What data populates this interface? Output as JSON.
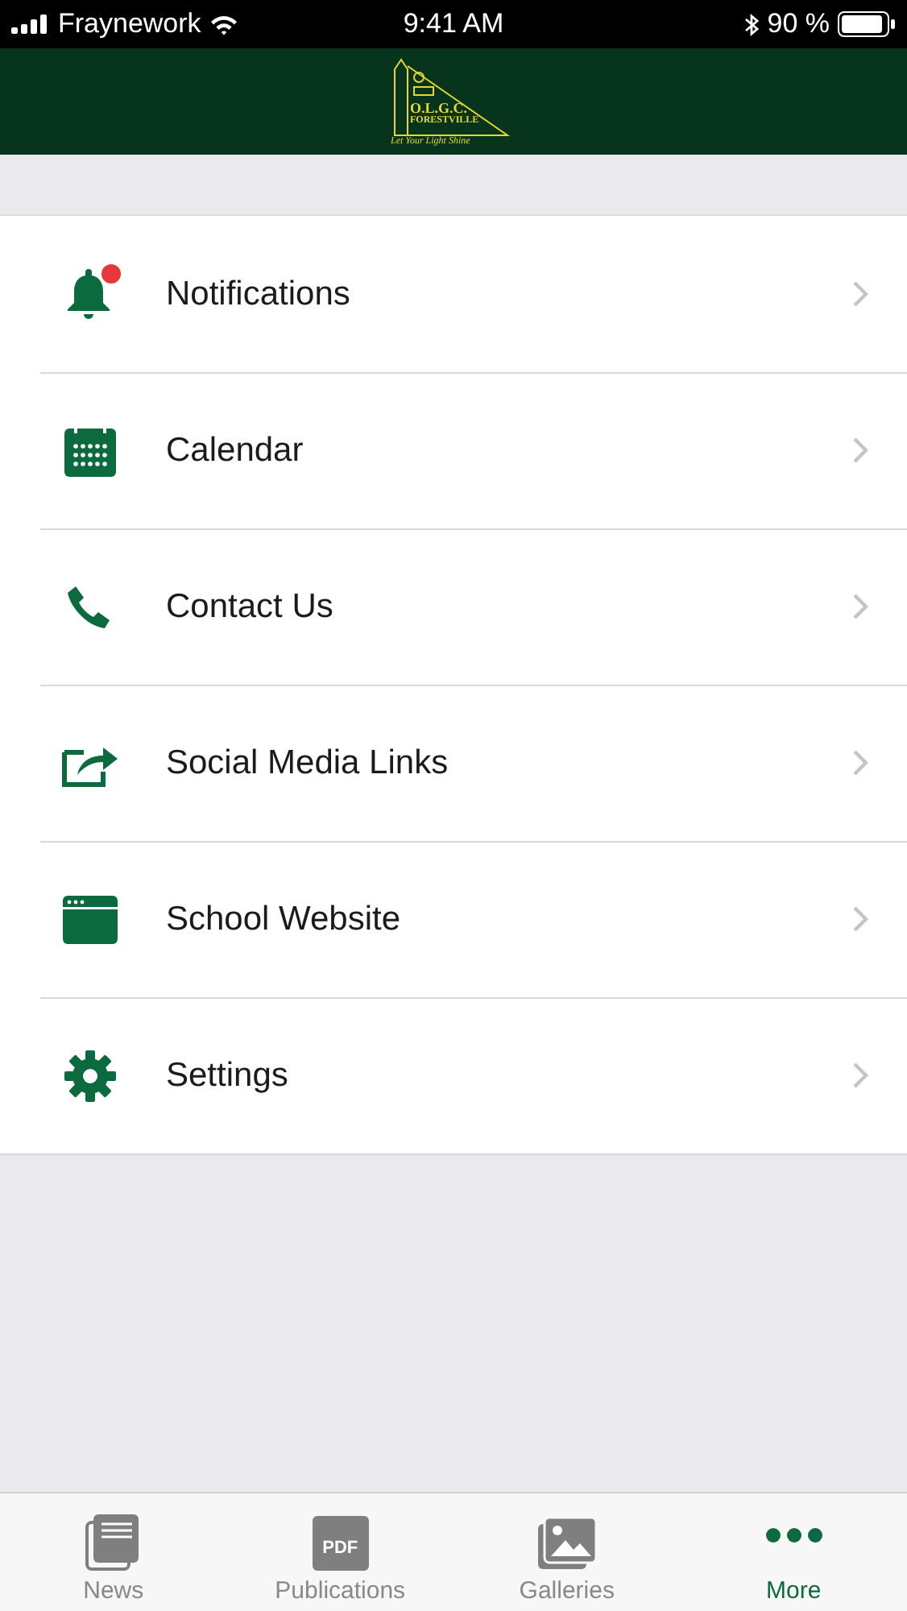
{
  "status_bar": {
    "carrier": "Fraynework",
    "time": "9:41 AM",
    "battery": "90 %"
  },
  "header": {
    "logo": {
      "title": "O.L.G.C.",
      "subtitle": "FORESTVILLE",
      "motto": "Let Your Light Shine"
    }
  },
  "menu": [
    {
      "kind": "bell",
      "label": "Notifications",
      "badge": true
    },
    {
      "kind": "calendar",
      "label": "Calendar",
      "badge": false
    },
    {
      "kind": "phone",
      "label": "Contact Us",
      "badge": false
    },
    {
      "kind": "share",
      "label": "Social Media Links",
      "badge": false
    },
    {
      "kind": "browser",
      "label": "School Website",
      "badge": false
    },
    {
      "kind": "gear",
      "label": "Settings",
      "badge": false
    }
  ],
  "tabs": [
    {
      "kind": "news",
      "label": "News",
      "selected": false
    },
    {
      "kind": "pdf",
      "label": "Publications",
      "icon_text": "PDF",
      "selected": false
    },
    {
      "kind": "gallery",
      "label": "Galleries",
      "selected": false
    },
    {
      "kind": "more",
      "label": "More",
      "selected": true
    }
  ]
}
